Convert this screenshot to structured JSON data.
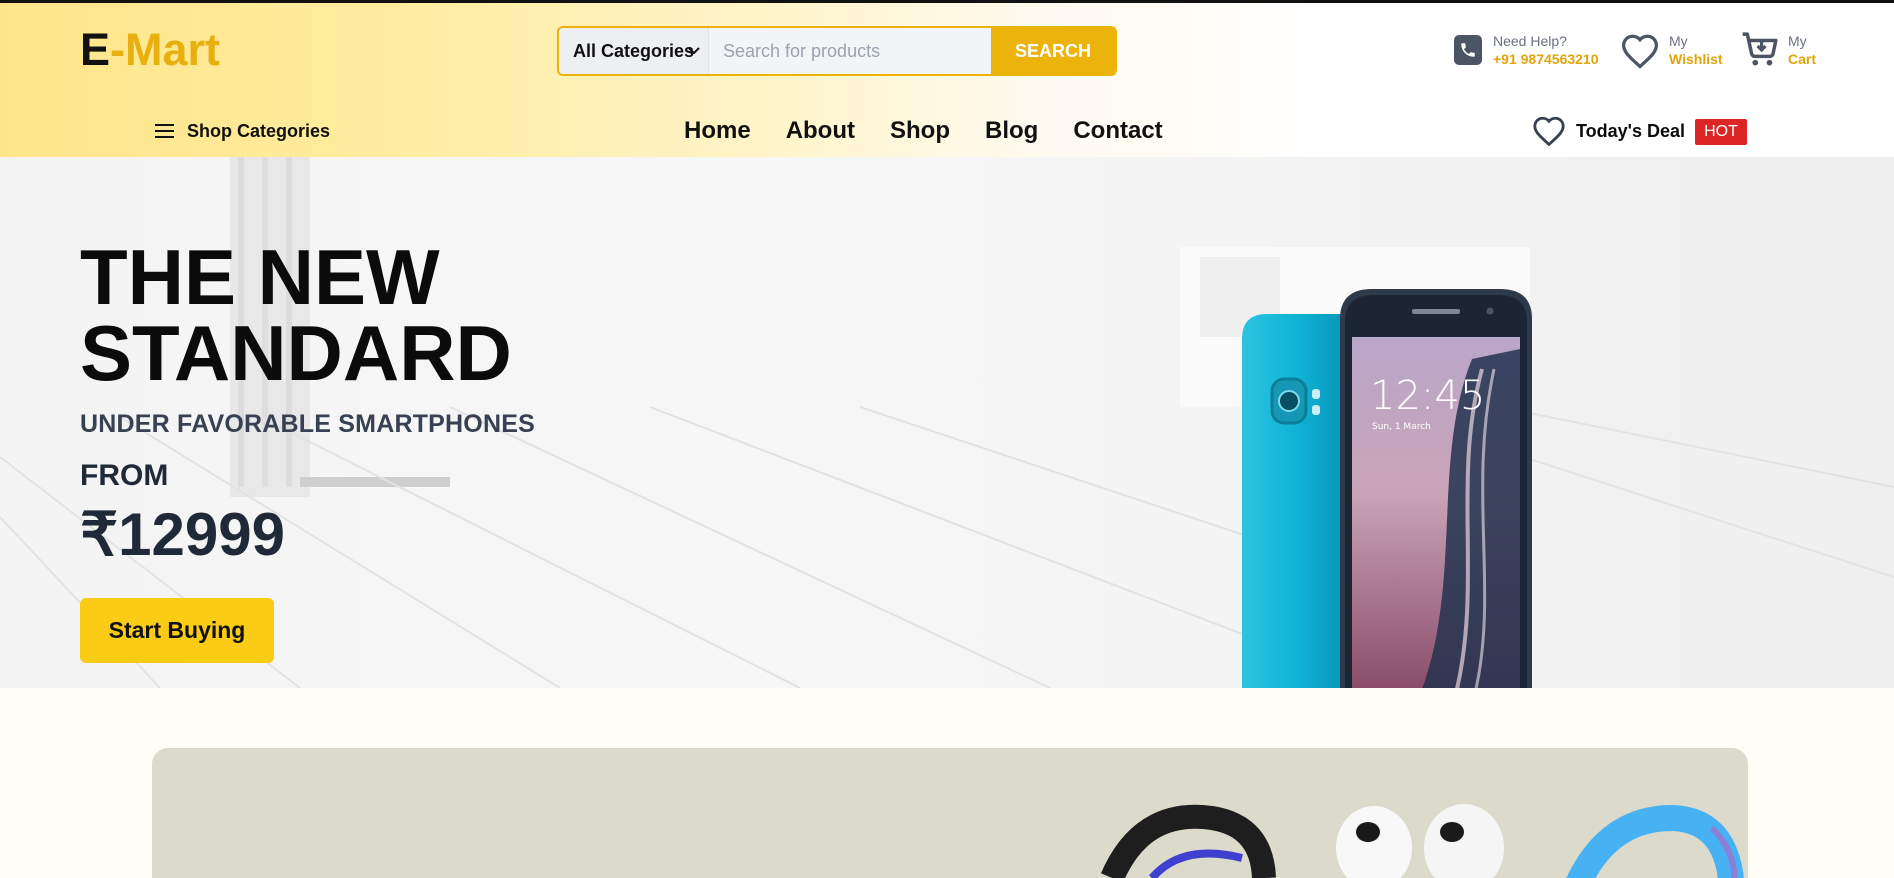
{
  "brand": {
    "logo_e": "E",
    "logo_rest": "-Mart"
  },
  "search": {
    "category_selected": "All Categories",
    "placeholder": "Search for products",
    "button_label": "SEARCH"
  },
  "help": {
    "title": "Need Help?",
    "phone": "+91 9874563210"
  },
  "wishlist": {
    "title": "My",
    "label": "Wishlist"
  },
  "cart": {
    "title": "My",
    "label": "Cart"
  },
  "nav": {
    "shop_categories": "Shop Categories",
    "links": [
      "Home",
      "About",
      "Shop",
      "Blog",
      "Contact"
    ],
    "deal_label": "Today's Deal",
    "deal_badge": "HOT"
  },
  "hero": {
    "headline_line1": "THE NEW",
    "headline_line2": "STANDARD",
    "subheading": "UNDER FAVORABLE SMARTPHONES",
    "from_label": "FROM",
    "price": "₹12999",
    "cta": "Start Buying",
    "phone_time": "12:45",
    "phone_date": "Sun, 1 March"
  },
  "colors": {
    "accent": "#ebb30c",
    "cta": "#facc15",
    "hot": "#dc2626",
    "promo_bg": "#dcdacb"
  }
}
